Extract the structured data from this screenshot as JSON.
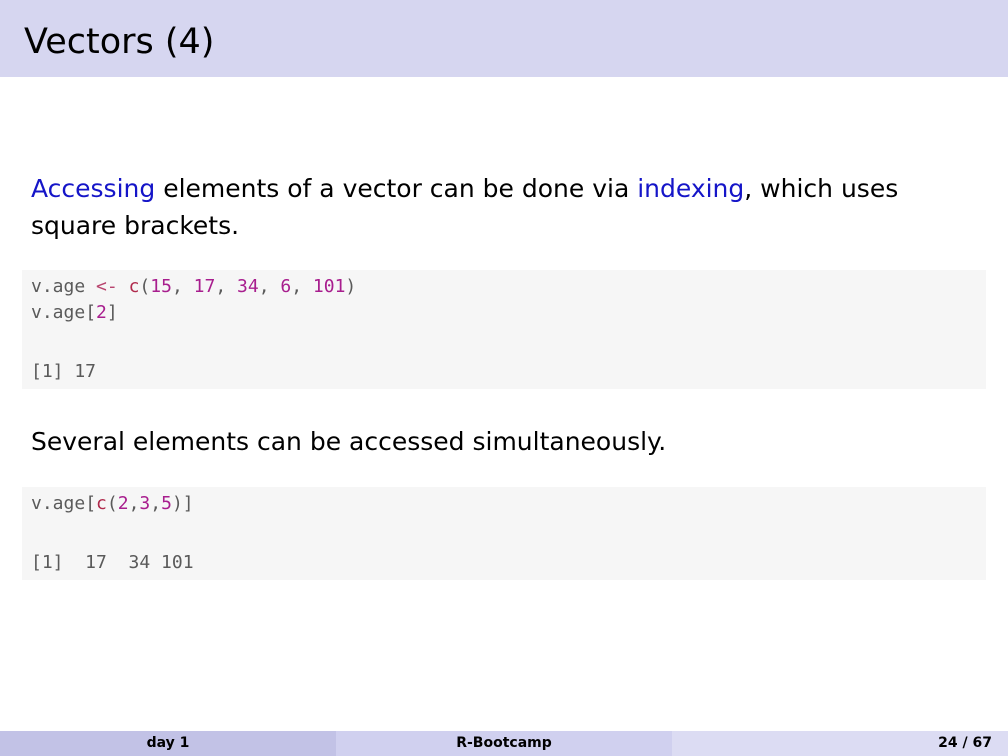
{
  "slide": {
    "title": "Vectors (4)",
    "para1": {
      "hl1": "Accessing",
      "mid1": " elements of a vector can be done via ",
      "hl2": "indexing",
      "rest": ", which uses square brackets."
    },
    "code1": {
      "line1": {
        "var": "v.age ",
        "op": "<-",
        "sp": " ",
        "fn": "c",
        "open": "(",
        "n1": "15",
        "c1": ", ",
        "n2": "17",
        "c2": ", ",
        "n3": "34",
        "c3": ", ",
        "n4": "6",
        "c4": ", ",
        "n5": "101",
        "close": ")"
      },
      "line2": {
        "var": "v.age",
        "open": "[",
        "n": "2",
        "close": "]"
      },
      "output": "[1] 17"
    },
    "para2": "Several elements can be accessed simultaneously.",
    "code2": {
      "line1": {
        "var": "v.age",
        "open": "[",
        "fn": "c",
        "popen": "(",
        "n1": "2",
        "c1": ",",
        "n2": "3",
        "c2": ",",
        "n3": "5",
        "pclose": ")",
        "close": "]"
      },
      "output": "[1]  17  34 101"
    }
  },
  "footer": {
    "left": "day 1",
    "center": "R-Bootcamp",
    "right": "24 / 67"
  },
  "colors": {
    "title_bar": "#d6d6f0",
    "highlight": "#1515c8",
    "code_bg": "#f6f6f6",
    "code_number": "#a81e8e"
  }
}
